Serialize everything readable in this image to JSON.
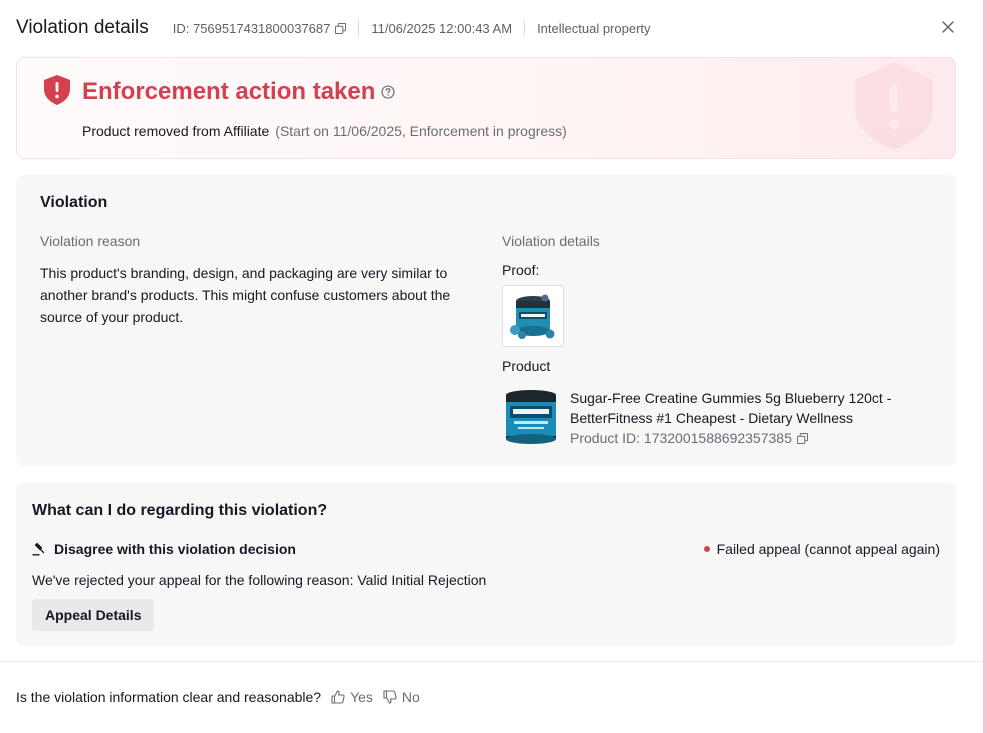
{
  "header": {
    "title": "Violation details",
    "id_text": "ID:  7569517431800037687",
    "timestamp": "11/06/2025 12:00:43 AM",
    "category": "Intellectual property"
  },
  "banner": {
    "headline": "Enforcement action taken",
    "action": "Product removed from Affiliate",
    "detail": "(Start on 11/06/2025, Enforcement in progress)"
  },
  "violation": {
    "title": "Violation",
    "reason_label": "Violation reason",
    "reason_text": "This product's branding, design, and packaging are very similar to another brand's products. This might confuse customers about the source of your product.",
    "details_label": "Violation details",
    "proof_label": "Proof:",
    "product_label": "Product",
    "product_name_line1": "Sugar-Free Creatine Gummies 5g Blueberry 120ct -",
    "product_name_line2": "BetterFitness #1 Cheapest - Dietary Wellness",
    "product_id": "Product ID: 1732001588692357385"
  },
  "appeal": {
    "title": "What can I do regarding this violation?",
    "disagree_label": "Disagree with this violation decision",
    "status": "Failed appeal (cannot appeal again)",
    "reject_text": "We've rejected your appeal for the following reason: Valid Initial Rejection",
    "button_label": "Appeal Details"
  },
  "feedback": {
    "question": "Is the violation information clear and reasonable?",
    "yes_label": "Yes",
    "no_label": "No"
  },
  "colors": {
    "accent_red": "#d4404f",
    "card_bg": "#f7f7f8",
    "muted_text": "#6b6c73"
  },
  "icons": {
    "copy": "copy-icon",
    "close": "close-icon",
    "shield": "shield-alert-icon",
    "help": "help-circle-icon",
    "gavel": "gavel-icon",
    "thumb_up": "thumb-up-icon",
    "thumb_down": "thumb-down-icon"
  }
}
